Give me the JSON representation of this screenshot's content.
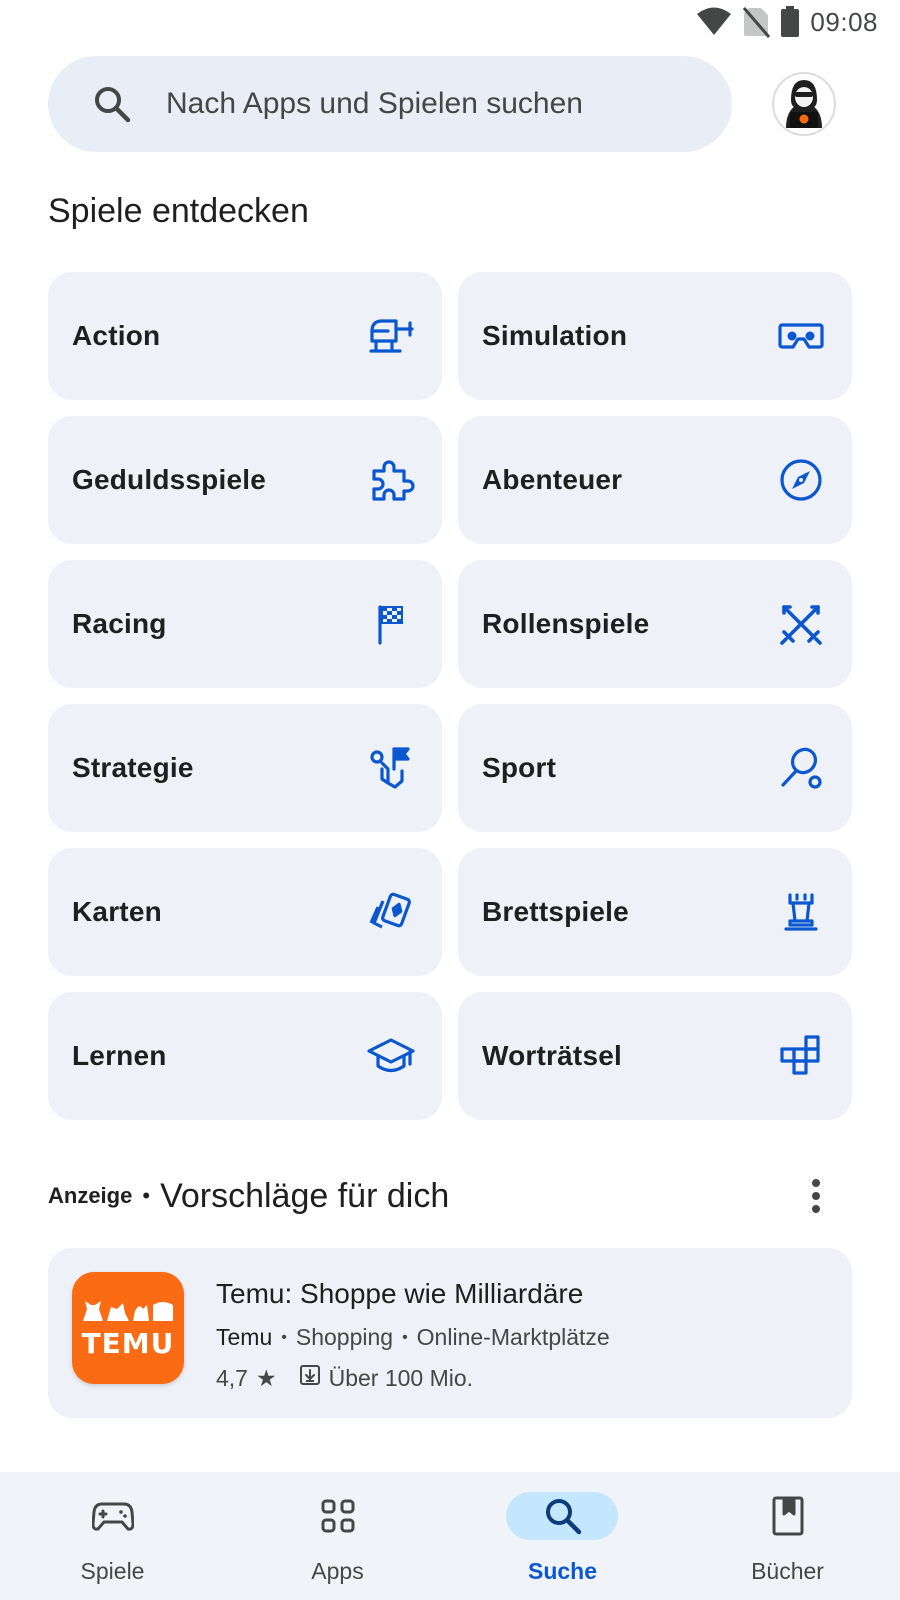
{
  "status_bar": {
    "time": "09:08",
    "icons": [
      "wifi-icon",
      "no-sim-icon",
      "battery-icon"
    ]
  },
  "search": {
    "placeholder": "Nach Apps und Spielen suchen",
    "icon": "search-icon"
  },
  "account": {
    "icon": "avatar-hacker"
  },
  "discover": {
    "title": "Spiele entdecken",
    "categories": [
      {
        "label": "Action",
        "icon": "helicopter-icon"
      },
      {
        "label": "Simulation",
        "icon": "vr-headset-icon"
      },
      {
        "label": "Geduldsspiele",
        "icon": "puzzle-icon"
      },
      {
        "label": "Abenteuer",
        "icon": "compass-icon"
      },
      {
        "label": "Racing",
        "icon": "checkered-flag-icon"
      },
      {
        "label": "Rollenspiele",
        "icon": "crossed-swords-icon"
      },
      {
        "label": "Strategie",
        "icon": "strategy-icon"
      },
      {
        "label": "Sport",
        "icon": "racket-icon"
      },
      {
        "label": "Karten",
        "icon": "cards-icon"
      },
      {
        "label": "Brettspiele",
        "icon": "chess-rook-icon"
      },
      {
        "label": "Lernen",
        "icon": "graduation-cap-icon"
      },
      {
        "label": "Worträtsel",
        "icon": "crossword-icon"
      }
    ]
  },
  "ads": {
    "tag": "Anzeige",
    "separator": "•",
    "title": "Vorschläge für dich",
    "app": {
      "name": "Temu: Shoppe wie Milliardäre",
      "icon_text": "TEMU",
      "developer": "Temu",
      "category": "Shopping",
      "subcategory": "Online-Marktplätze",
      "rating": "4,7",
      "rating_star": "★",
      "downloads": "Über 100 Mio.",
      "icon_color": "#fb6b13"
    }
  },
  "bottom_nav": {
    "items": [
      {
        "label": "Spiele",
        "icon": "gamepad-icon",
        "active": false
      },
      {
        "label": "Apps",
        "icon": "apps-grid-icon",
        "active": false
      },
      {
        "label": "Suche",
        "icon": "search-icon",
        "active": true
      },
      {
        "label": "Bücher",
        "icon": "book-icon",
        "active": false
      }
    ]
  },
  "colors": {
    "accent": "#0b57d0",
    "tile_bg": "#eef2f8",
    "search_bg": "#e9eef6",
    "nav_active_pill": "#c2e7ff"
  }
}
